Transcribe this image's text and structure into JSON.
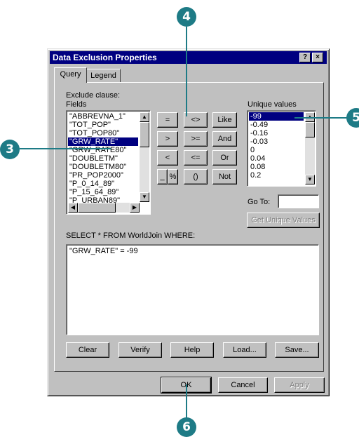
{
  "window": {
    "title": "Data Exclusion Properties",
    "help_btn": "?",
    "close_btn": "×"
  },
  "tabs": [
    {
      "label": "Query"
    },
    {
      "label": "Legend"
    }
  ],
  "query": {
    "exclude_clause_label": "Exclude clause:",
    "fields_label": "Fields",
    "fields": [
      "\"ABBREVNA_1\"",
      "\"TOT_POP\"",
      "\"TOT_POP80\"",
      "\"GRW_RATE\"",
      "\"GRW_RATE80\"",
      "\"DOUBLETM\"",
      "\"DOUBLETM80\"",
      "\"PR_POP2000\"",
      "\"P_0_14_89\"",
      "\"P_15_64_89\"",
      "\"P_URBAN89\""
    ],
    "selected_field": "\"GRW_RATE\"",
    "operators": [
      "=",
      "<>",
      "Like",
      ">",
      ">=",
      "And",
      "<",
      "<=",
      "Or",
      "_",
      "%",
      "()",
      "Not"
    ],
    "unique_values_label": "Unique values",
    "unique_values": [
      "-99",
      "-0.49",
      "-0.16",
      "-0.03",
      "0",
      "0.04",
      "0.08",
      "0.2"
    ],
    "selected_value": "-99",
    "goto_label": "Go To:",
    "goto_value": "",
    "get_unique_values": "Get Unique Values",
    "select_label": "SELECT * FROM WorldJoin WHERE:",
    "expression": "\"GRW_RATE\" = -99",
    "buttons": {
      "clear": "Clear",
      "verify": "Verify",
      "help": "Help",
      "load": "Load...",
      "save": "Save..."
    }
  },
  "footer": {
    "ok": "OK",
    "cancel": "Cancel",
    "apply": "Apply"
  },
  "callouts": [
    "3",
    "4",
    "5",
    "6"
  ],
  "colors": {
    "callout": "#1e7b86",
    "titlebar": "#000080",
    "selection": "#000080"
  }
}
